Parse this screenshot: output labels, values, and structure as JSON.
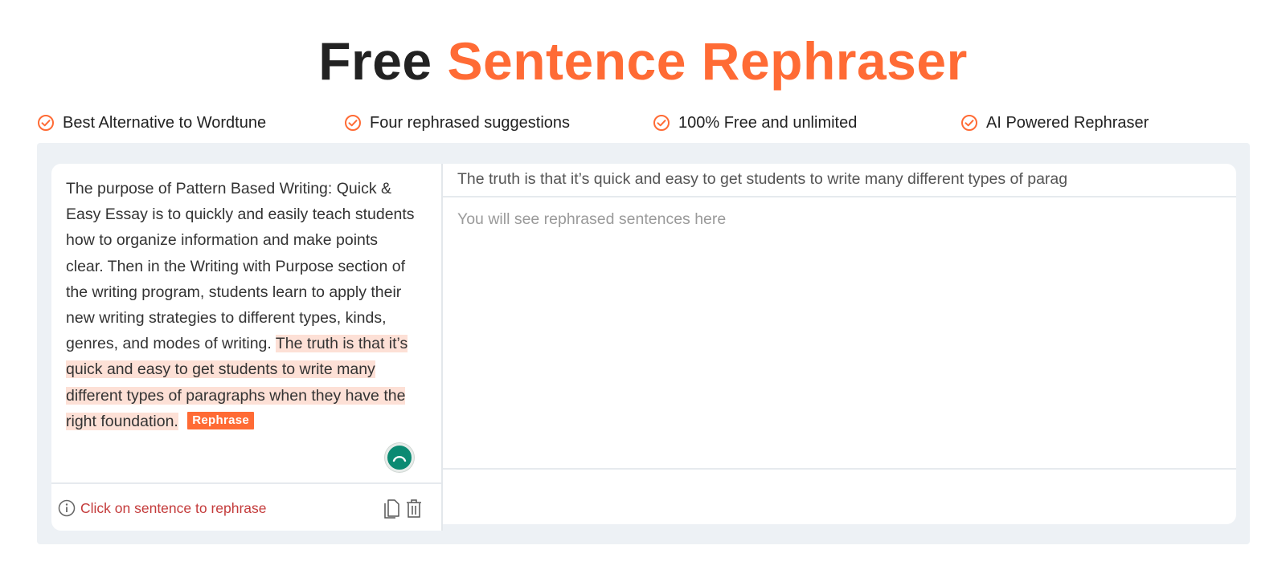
{
  "header": {
    "title_part1": "Free",
    "title_part2": "Sentence Rephraser"
  },
  "features": [
    {
      "label": "Best Alternative to Wordtune",
      "icon": "check-circle-icon"
    },
    {
      "label": "Four rephrased suggestions",
      "icon": "check-circle-icon"
    },
    {
      "label": "100% Free and unlimited",
      "icon": "check-circle-icon"
    },
    {
      "label": "AI Powered Rephraser",
      "icon": "check-circle-icon"
    }
  ],
  "editor": {
    "text_plain": "The purpose of Pattern Based Writing: Quick & Easy Essay is to quickly and easily teach students how to organize information and make points clear. Then in the Writing with Purpose section of the writing program, students learn to apply their new writing strategies to different types, kinds, genres, and modes of writing.",
    "text_highlighted": "The truth is that it’s quick and easy to get students to write many different types of paragraphs when they have the right foundation.",
    "rephrase_label": "Rephrase",
    "hint": "Click on sentence to rephrase",
    "hint_icon": "info-icon",
    "copy_icon": "copy-icon",
    "delete_icon": "trash-icon",
    "status_icon": "loading-spinner-icon"
  },
  "results": {
    "selected_sentence": "The truth is that it’s quick and easy to get students to write many different types of parag",
    "placeholder": "You will see rephrased sentences here"
  },
  "colors": {
    "accent": "#ff6b35",
    "highlight": "#fde0d6",
    "hint_text": "#c43b3b",
    "spinner": "#0b8a72",
    "workspace_bg": "#edf1f5"
  }
}
